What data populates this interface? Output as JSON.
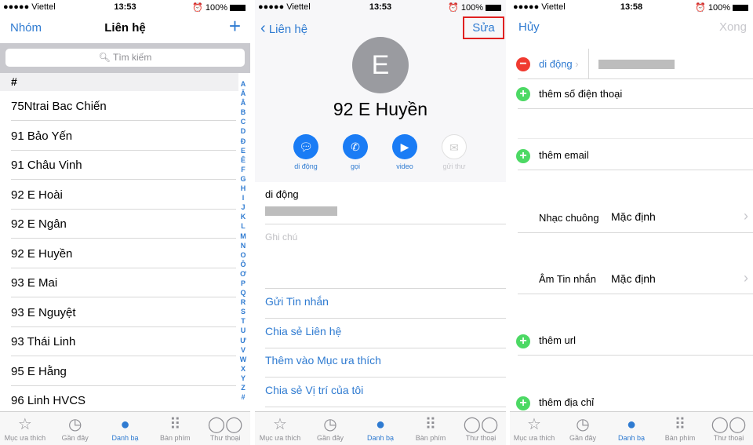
{
  "status": [
    {
      "carrier": "●●●●● Viettel",
      "time": "13:53",
      "battery": "100%"
    },
    {
      "carrier": "●●●●● Viettel",
      "time": "13:53",
      "battery": "100%"
    },
    {
      "carrier": "●●●●● Viettel",
      "time": "13:58",
      "battery": "100%"
    }
  ],
  "list": {
    "left": "Nhóm",
    "title": "Liên hệ",
    "add": "+",
    "search_placeholder": "Tìm kiếm",
    "section": "#",
    "contacts": [
      "75Ntrai Bac Chiến",
      "91 Bảo Yến",
      "91 Châu Vinh",
      "92 E Hoài",
      "92 E Ngân",
      "92 E Huyền",
      "93 E Mai",
      "93 E Nguyệt",
      "93 Thái Linh",
      "95 E Hằng",
      "96 Linh HVCS"
    ],
    "index": [
      "A",
      "Ă",
      "Â",
      "B",
      "C",
      "D",
      "Đ",
      "E",
      "Ê",
      "F",
      "G",
      "H",
      "I",
      "J",
      "K",
      "L",
      "M",
      "N",
      "O",
      "Ô",
      "Ơ",
      "P",
      "Q",
      "R",
      "S",
      "T",
      "U",
      "Ư",
      "V",
      "W",
      "X",
      "Y",
      "Z",
      "#"
    ]
  },
  "detail": {
    "back": "Liên hệ",
    "edit": "Sửa",
    "initial": "E",
    "name": "92 E Huyền",
    "actions": [
      {
        "label": "di động",
        "icon": "message-icon"
      },
      {
        "label": "gọi",
        "icon": "phone-icon"
      },
      {
        "label": "video",
        "icon": "video-icon"
      },
      {
        "label": "gửi thư",
        "icon": "mail-icon"
      }
    ],
    "phone_label": "di động",
    "notes_placeholder": "Ghi chú",
    "links": [
      "Gửi Tin nhắn",
      "Chia sẻ Liên hệ",
      "Thêm vào Mục ưa thích",
      "Chia sẻ Vị trí của tôi"
    ]
  },
  "edit": {
    "cancel": "Hủy",
    "done": "Xong",
    "phone_label": "di động",
    "add_phone": "thêm số điện thoại",
    "add_email": "thêm email",
    "ringtone_label": "Nhạc chuông",
    "ringtone_value": "Mặc định",
    "text_tone_label": "Âm Tin nhắn",
    "text_tone_value": "Mặc định",
    "add_url": "thêm url",
    "add_address": "thêm địa chỉ"
  },
  "tabs": [
    "Mục ưa thích",
    "Gần đây",
    "Danh bạ",
    "Bàn phím",
    "Thư thoại"
  ],
  "colors": {
    "accent": "#2f7bd1",
    "highlight_box": "#e02020"
  }
}
